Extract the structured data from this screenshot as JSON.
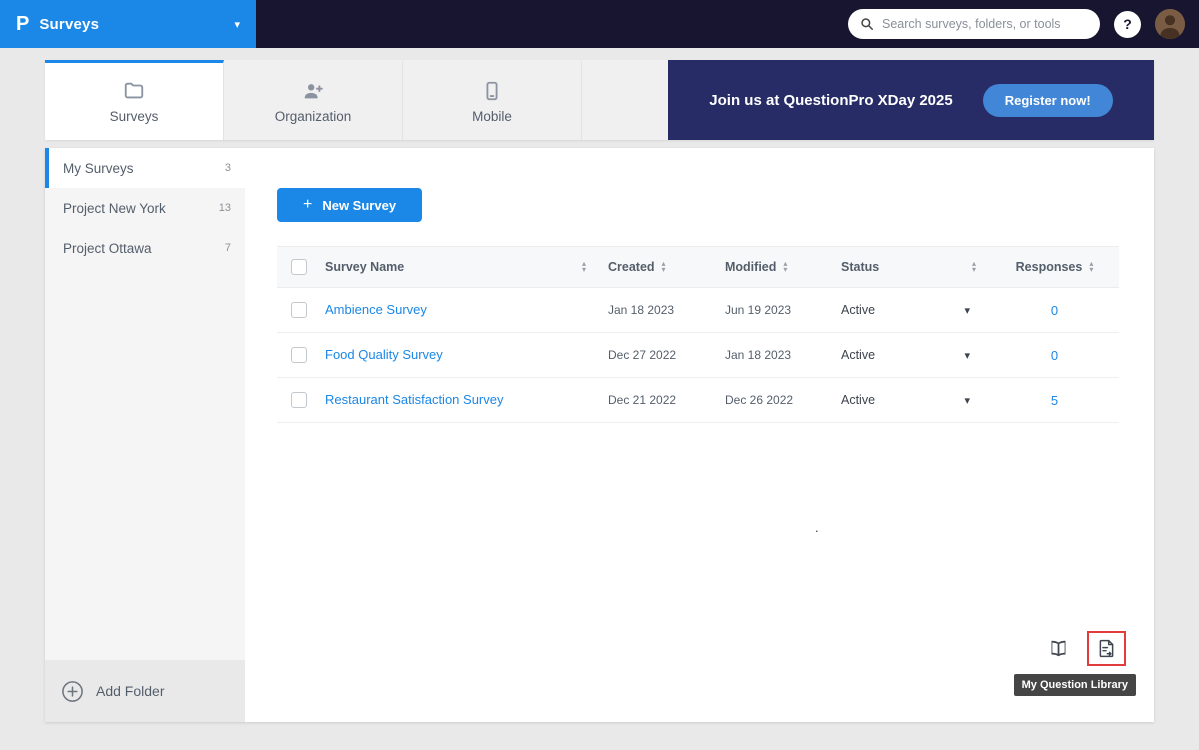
{
  "topbar": {
    "logo_glyph": "P",
    "app_name": "Surveys",
    "search_placeholder": "Search surveys, folders, or tools",
    "help_label": "?"
  },
  "icons": {
    "caret_down": "▾",
    "sort_up": "▴",
    "sort_down": "▾",
    "plus": "+",
    "dot": "."
  },
  "tabs": [
    {
      "label": "Surveys",
      "active": true
    },
    {
      "label": "Organization",
      "active": false
    },
    {
      "label": "Mobile",
      "active": false
    }
  ],
  "banner": {
    "text": "Join us at QuestionPro XDay 2025",
    "button_label": "Register now!"
  },
  "sidebar": {
    "items": [
      {
        "label": "My Surveys",
        "count": "3",
        "active": true
      },
      {
        "label": "Project New York",
        "count": "13",
        "active": false
      },
      {
        "label": "Project Ottawa",
        "count": "7",
        "active": false
      }
    ],
    "add_folder_label": "Add Folder"
  },
  "main": {
    "new_survey_label": "New Survey",
    "table": {
      "headers": [
        "Survey Name",
        "Created",
        "Modified",
        "Status",
        "Responses"
      ],
      "rows": [
        {
          "name": "Ambience Survey",
          "created": "Jan 18 2023",
          "modified": "Jun 19 2023",
          "status": "Active",
          "responses": "0"
        },
        {
          "name": "Food Quality Survey",
          "created": "Dec 27 2022",
          "modified": "Jan 18 2023",
          "status": "Active",
          "responses": "0"
        },
        {
          "name": "Restaurant Satisfaction Survey",
          "created": "Dec 21 2022",
          "modified": "Dec 26 2022",
          "status": "Active",
          "responses": "5"
        }
      ]
    },
    "tooltip": "My Question Library"
  },
  "colors": {
    "accent_blue": "#1b87e6",
    "topbar_dark": "#17152f",
    "banner_navy": "#272c66",
    "highlight_red": "#e23b3b"
  }
}
